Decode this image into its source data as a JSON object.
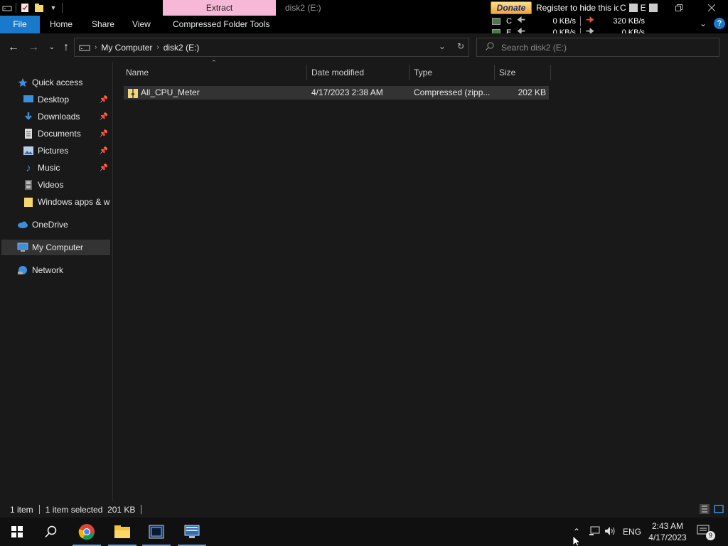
{
  "window": {
    "title": "disk2 (E:)",
    "contextual_tab": "Extract"
  },
  "ribbon": {
    "tabs": [
      "File",
      "Home",
      "Share",
      "View",
      "Compressed Folder Tools"
    ]
  },
  "netmeter": {
    "donate": "Donate",
    "register_text": "Register to hide this icon",
    "header_c": "C",
    "header_e": "E",
    "rows": [
      {
        "drive": "C",
        "read": "0 KB/s",
        "write": "320 KB/s"
      },
      {
        "drive": "E",
        "read": "0 KB/s",
        "write": "0 KB/s"
      }
    ]
  },
  "address": {
    "crumbs": [
      "My Computer",
      "disk2 (E:)"
    ]
  },
  "search": {
    "placeholder": "Search disk2 (E:)"
  },
  "navpane": {
    "quick_access": "Quick access",
    "pinned": [
      "Desktop",
      "Downloads",
      "Documents",
      "Pictures",
      "Music"
    ],
    "videos": "Videos",
    "windows_apps": "Windows apps & w",
    "onedrive": "OneDrive",
    "my_computer": "My Computer",
    "network": "Network"
  },
  "columns": {
    "name": "Name",
    "date": "Date modified",
    "type": "Type",
    "size": "Size"
  },
  "files": [
    {
      "name": "All_CPU_Meter",
      "date": "4/17/2023 2:38 AM",
      "type": "Compressed (zipp...",
      "size": "202 KB"
    }
  ],
  "status": {
    "count": "1 item",
    "selection": "1 item selected  201 KB"
  },
  "taskbar": {
    "language": "ENG",
    "time": "2:43 AM",
    "date": "4/17/2023",
    "notifications": "9"
  },
  "colors": {
    "accent": "#1979ca",
    "extract_tab": "#f6b8d6",
    "background": "#191919",
    "selected_row": "#333333"
  }
}
